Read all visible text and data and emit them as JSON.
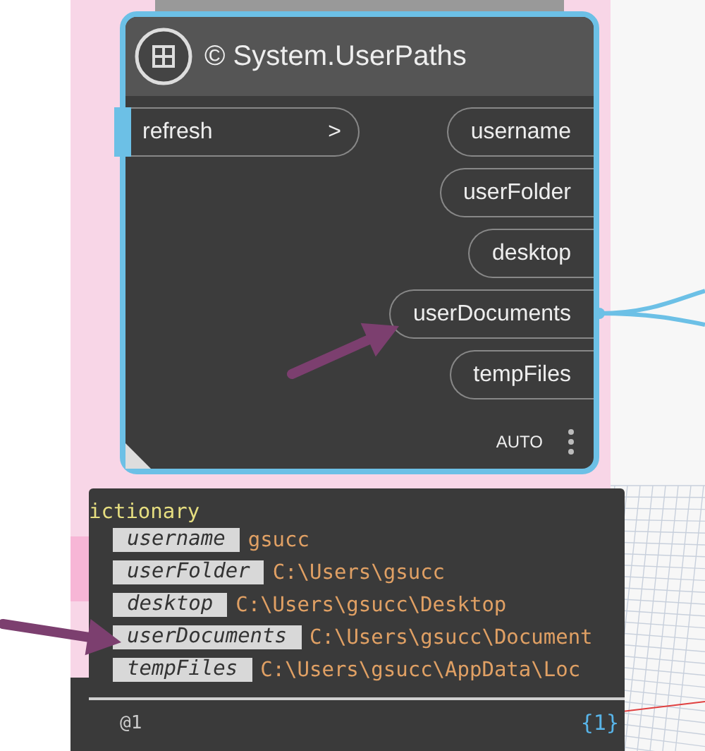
{
  "node": {
    "title": "© System.UserPaths",
    "selected": true,
    "run_mode": "AUTO",
    "inputs": [
      {
        "label": "refresh",
        "arrow": ">"
      }
    ],
    "outputs": [
      {
        "label": "username"
      },
      {
        "label": "userFolder"
      },
      {
        "label": "desktop"
      },
      {
        "label": "userDocuments"
      },
      {
        "label": "tempFiles"
      }
    ]
  },
  "preview": {
    "type_label": "ictionary",
    "level_label": "@1",
    "count": "{1}",
    "entries": [
      {
        "key": "username",
        "value": "gsucc"
      },
      {
        "key": "userFolder",
        "value": "C:\\Users\\gsucc"
      },
      {
        "key": "desktop",
        "value": "C:\\Users\\gsucc\\Desktop"
      },
      {
        "key": "userDocuments",
        "value": "C:\\Users\\gsucc\\Document"
      },
      {
        "key": "tempFiles",
        "value": "C:\\Users\\gsucc\\AppData\\Loc"
      }
    ]
  }
}
